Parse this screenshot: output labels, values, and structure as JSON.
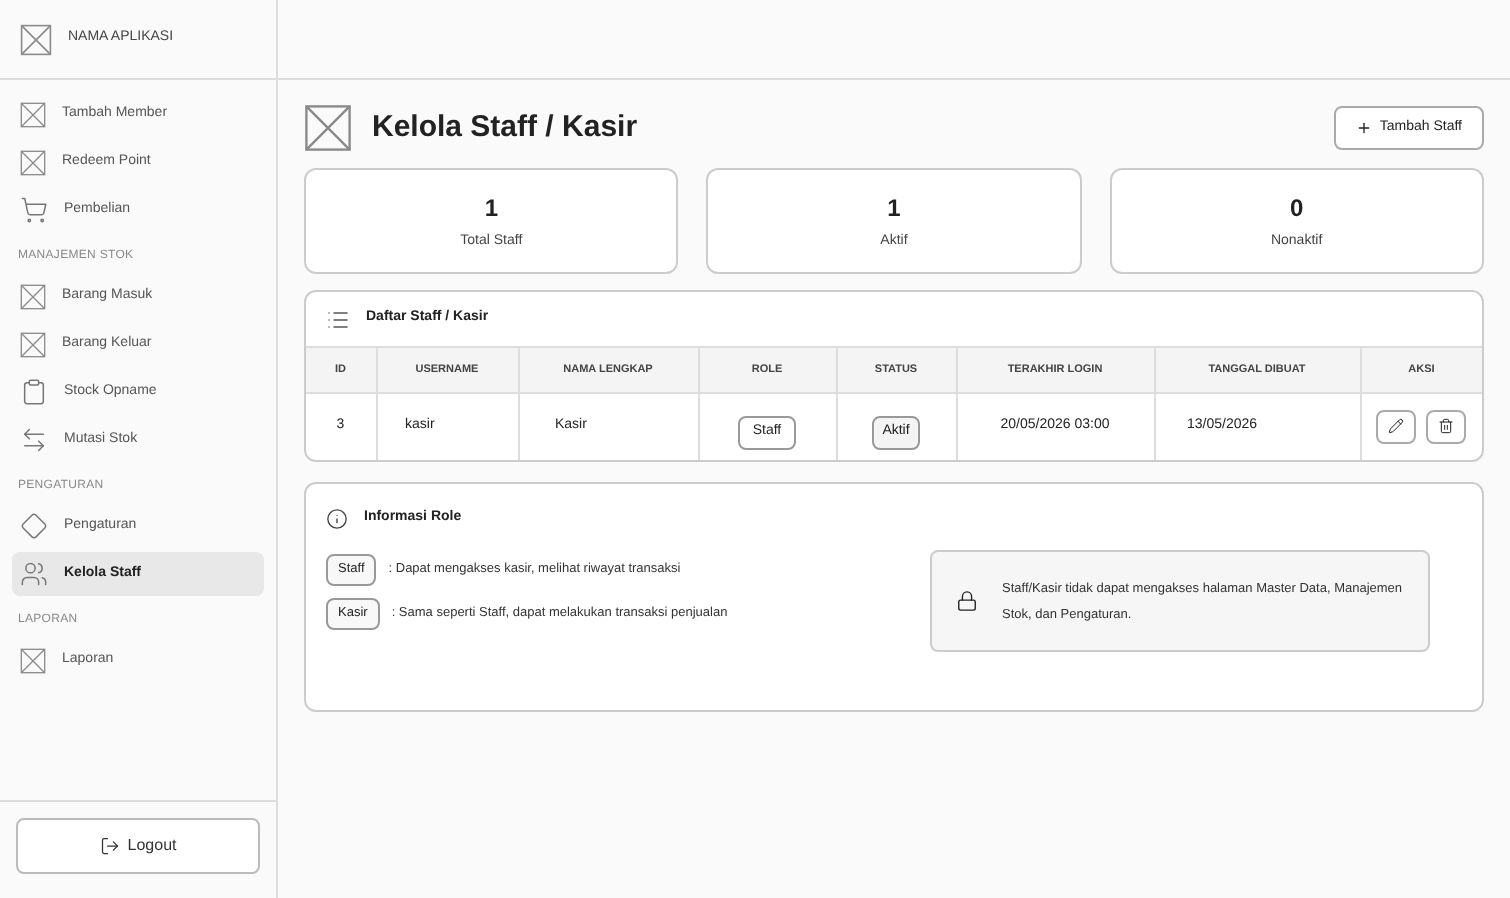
{
  "app_name": "NAMA APLIKASI",
  "sidebar": {
    "groups": [
      {
        "items": [
          {
            "label": "Tambah Member",
            "selected": false
          },
          {
            "label": "Redeem Point",
            "selected": false
          },
          {
            "label": "Pembelian",
            "selected": false
          }
        ]
      },
      {
        "heading": "MANAJEMEN STOK",
        "items": [
          {
            "label": "Barang Masuk",
            "selected": false
          },
          {
            "label": "Barang Keluar",
            "selected": false
          },
          {
            "label": "Stock Opname",
            "selected": false
          },
          {
            "label": "Mutasi Stok",
            "selected": false
          }
        ]
      },
      {
        "heading": "PENGATURAN",
        "items": [
          {
            "label": "Pengaturan",
            "selected": false
          },
          {
            "label": "Kelola Staff",
            "selected": true
          }
        ]
      },
      {
        "heading": "LAPORAN",
        "items": [
          {
            "label": "Laporan",
            "selected": false
          }
        ]
      }
    ],
    "logout": "Logout"
  },
  "page_title": "Kelola Staff / Kasir",
  "add_button": "Tambah Staff",
  "stats": [
    {
      "value": "1",
      "label": "Total Staff"
    },
    {
      "value": "1",
      "label": "Aktif"
    },
    {
      "value": "0",
      "label": "Nonaktif"
    }
  ],
  "table": {
    "title": "Daftar Staff / Kasir",
    "columns": [
      "ID",
      "USERNAME",
      "NAMA LENGKAP",
      "ROLE",
      "STATUS",
      "TERAKHIR LOGIN",
      "TANGGAL DIBUAT",
      "AKSI"
    ],
    "rows": [
      {
        "id": "3",
        "username": "kasir",
        "name": "Kasir",
        "role": "Staff",
        "status": "Aktif",
        "last_login": "20/05/2026 03:00",
        "created": "13/05/2026"
      }
    ]
  },
  "role_info": {
    "title": "Informasi Role",
    "roles": [
      {
        "role": "Staff",
        "description": ": Dapat mengakses kasir, melihat riwayat transaksi"
      },
      {
        "role": "Kasir",
        "description": ": Sama seperti Staff, dapat melakukan transaksi penjualan"
      }
    ],
    "notice": "Staff/Kasir tidak dapat mengakses halaman Master Data, Manajemen Stok, dan Pengaturan."
  }
}
